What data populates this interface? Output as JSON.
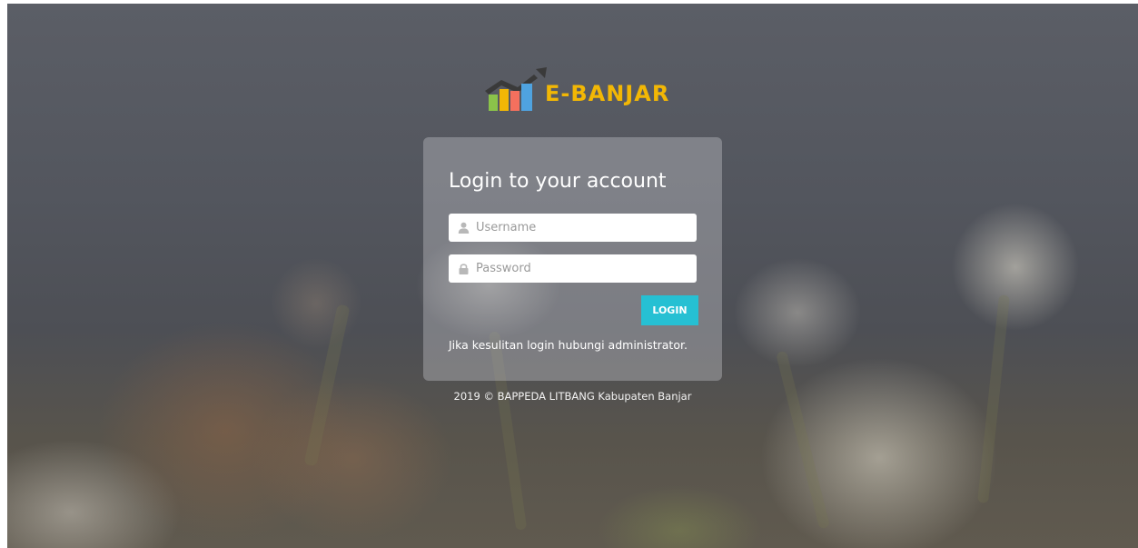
{
  "brand": {
    "name": "E-BANJAR",
    "colors": {
      "text": "#f2b705",
      "bar1": "#8bc34a",
      "bar2": "#f2b705",
      "bar3": "#f4705e",
      "bar4": "#4fa3e0",
      "roof": "#3a3a3a"
    },
    "icon": "bar-chart-growth-icon"
  },
  "login": {
    "title": "Login to your account",
    "username": {
      "placeholder": "Username",
      "value": "",
      "icon": "user-icon"
    },
    "password": {
      "placeholder": "Password",
      "value": "",
      "icon": "lock-icon"
    },
    "submit_label": "LOGIN",
    "help_text": "Jika kesulitan login hubungi administrator.",
    "accent_color": "#26c0d3"
  },
  "footer": {
    "text": "2019 © BAPPEDA LITBANG Kabupaten Banjar"
  }
}
